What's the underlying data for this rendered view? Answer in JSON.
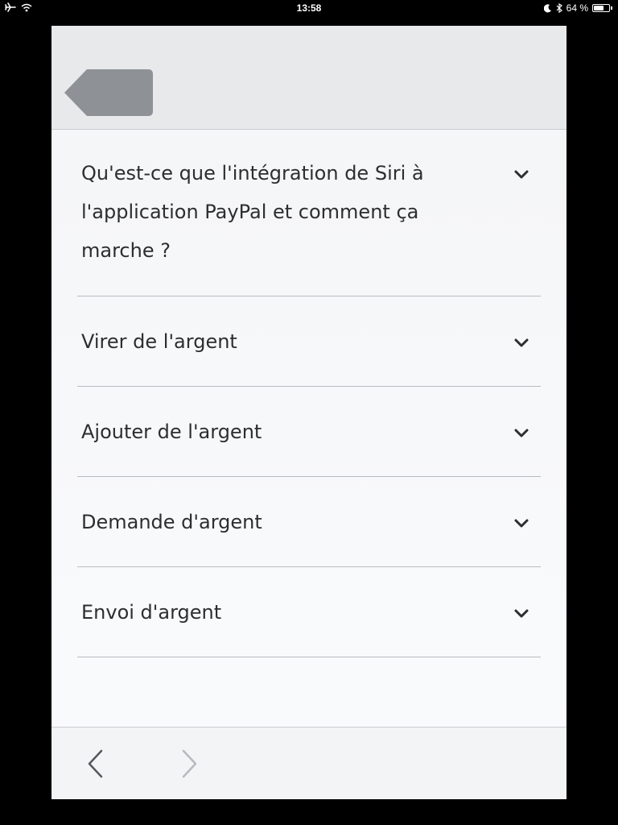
{
  "status": {
    "time": "13:58",
    "battery_text": "64 %",
    "battery_level": 0.64,
    "icons": [
      "airplane-icon",
      "wifi-icon",
      "moon-icon",
      "bluetooth-icon",
      "battery-icon"
    ]
  },
  "header": {
    "back_icon": "back-tag-icon"
  },
  "faq": {
    "items": [
      {
        "label": "Qu'est-ce que l'intégration de Siri à l'application PayPal et comment ça marche ?"
      },
      {
        "label": "Virer de l'argent"
      },
      {
        "label": "Ajouter de l'argent"
      },
      {
        "label": "Demande d'argent"
      },
      {
        "label": "Envoi d'argent"
      }
    ]
  },
  "footer": {
    "back_icon": "chevron-left-icon",
    "forward_icon": "chevron-right-icon"
  },
  "colors": {
    "background": "#000000",
    "sheet": "#f6f7f9",
    "header": "#e8e9eb",
    "back_tag": "#8e9297",
    "text": "#2c2e2f",
    "divider": "#b9bcc0",
    "nav_back": "#54585c",
    "nav_forward_disabled": "#b6babe"
  }
}
